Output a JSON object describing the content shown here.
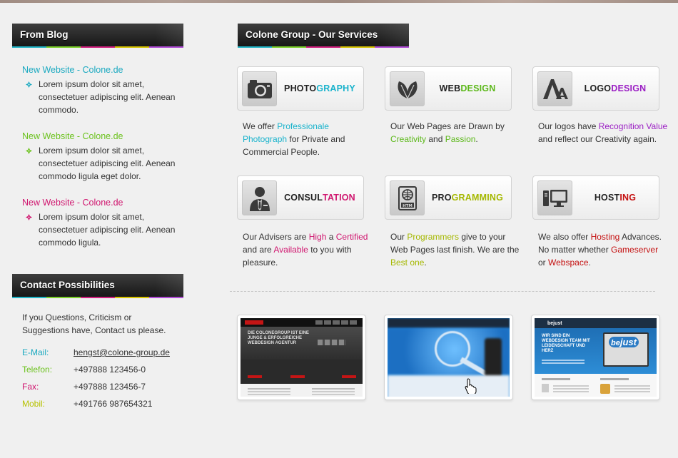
{
  "sidebar": {
    "blog_heading": "From Blog",
    "blog_items": [
      {
        "title": "New Website - Colone.de",
        "text": "Lorem ipsum dolor sit amet, consectetuer adipiscing elit. Aenean commodo.",
        "color": "#1aa9c0"
      },
      {
        "title": "New Website - Colone.de",
        "text": "Lorem ipsum dolor sit amet, consectetuer adipiscing elit. Aenean commodo ligula eget dolor.",
        "color": "#6cc21e"
      },
      {
        "title": "New Website - Colone.de",
        "text": "Lorem ipsum dolor sit amet, consectetuer adipiscing elit. Aenean commodo ligula.",
        "color": "#d0166f"
      }
    ],
    "contact_heading": "Contact Possibilities",
    "contact_intro": "If you Questions, Criticism or Suggestions have, Contact us please.",
    "contacts": [
      {
        "label": "E-Mail:",
        "value": "hengst@colone-group.de",
        "color": "#1aa9c0"
      },
      {
        "label": "Telefon:",
        "value": "+497888 123456-0",
        "color": "#6cc21e"
      },
      {
        "label": "Fax:",
        "value": "+497888 123456-7",
        "color": "#d0166f"
      },
      {
        "label": "Mobil:",
        "value": "+491766 987654321",
        "color": "#b7c200"
      }
    ]
  },
  "services": {
    "heading": "Colone Group - Our Services",
    "items": [
      {
        "icon": "camera-icon",
        "name_a": "PHOTO",
        "name_b": "GRAPHY",
        "color": "#1ab3cc",
        "desc": [
          [
            "We offer ",
            false
          ],
          [
            "Professionale Photograph",
            true
          ],
          [
            " for Private and Commercial People.",
            false
          ]
        ]
      },
      {
        "icon": "leaf-icon",
        "name_a": "WEB",
        "name_b": "DESIGN",
        "color": "#5cb81a",
        "desc": [
          [
            "Our Web Pages are Drawn by ",
            false
          ],
          [
            "Creativity",
            true
          ],
          [
            " and ",
            false
          ],
          [
            "Passion",
            true
          ],
          [
            ".",
            false
          ]
        ]
      },
      {
        "icon": "font-icon",
        "name_a": "LOGO",
        "name_b": "DESIGN",
        "color": "#9b1fc4",
        "desc": [
          [
            "Our logos have ",
            false
          ],
          [
            "Recognition Value",
            true
          ],
          [
            " and reflect our Creativity again.",
            false
          ]
        ]
      },
      {
        "icon": "person-icon",
        "name_a": "CONSUL",
        "name_b": "TATION",
        "color": "#d0166f",
        "desc": [
          [
            "Our Advisers are ",
            false
          ],
          [
            "High",
            true
          ],
          [
            " a ",
            false
          ],
          [
            "Certified",
            true
          ],
          [
            " and are ",
            false
          ],
          [
            "Available",
            true
          ],
          [
            " to you with pleasure.",
            false
          ]
        ]
      },
      {
        "icon": "html-file-icon",
        "name_a": "PRO",
        "name_b": "GRAMMING",
        "color": "#a5b800",
        "desc": [
          [
            "Our ",
            false
          ],
          [
            "Programmers",
            true
          ],
          [
            " give to your Web Pages last finish. We are the ",
            false
          ],
          [
            "Best one",
            true
          ],
          [
            ".",
            false
          ]
        ]
      },
      {
        "icon": "monitor-icon",
        "name_a": "HOST",
        "name_b": "ING",
        "color": "#c41010",
        "desc": [
          [
            "We also offer ",
            false
          ],
          [
            "Hosting",
            true
          ],
          [
            " Advances. No matter whether ",
            false
          ],
          [
            "Gameserver",
            true
          ],
          [
            " or ",
            false
          ],
          [
            "Webspace",
            true
          ],
          [
            ".",
            false
          ]
        ]
      }
    ]
  },
  "portfolio": {
    "thumbs": [
      {
        "name": "colonegroup-site-thumb",
        "hero": "DIE COLONEGROUP IST EINE JUNGE & ERFOLGREICHE WEBDESIGN AGENTUR"
      },
      {
        "name": "blurred-search-site-thumb",
        "hero": ""
      },
      {
        "name": "bejust-site-thumb",
        "hero": "WIR SIND EIN WEBDESIGN TEAM MIT LEIDENSCHAFT UND HERZ",
        "brand": "bejust"
      }
    ]
  }
}
